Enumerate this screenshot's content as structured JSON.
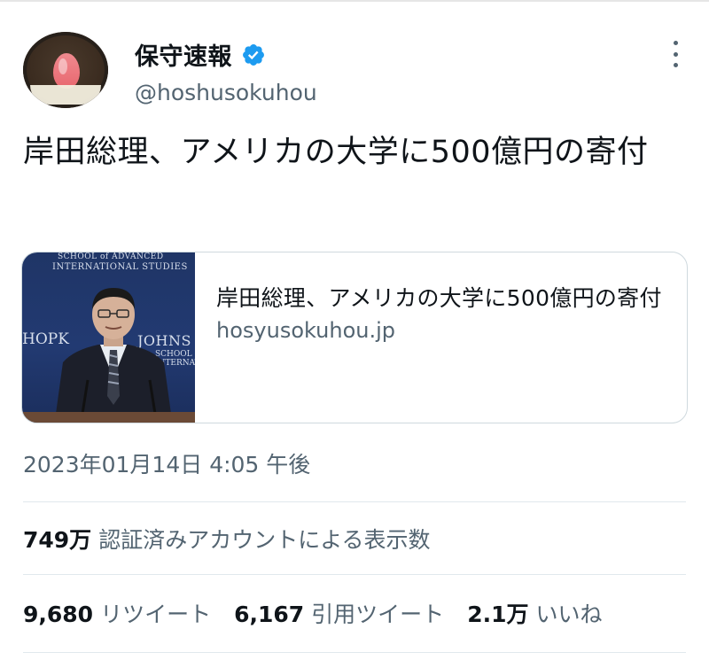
{
  "tweet": {
    "author": {
      "display_name": "保守速報",
      "handle": "@hoshusokuhou",
      "verified": true,
      "avatar_icon": "strawberry-mochi-avatar"
    },
    "text": "岸田総理、アメリカの大学に500億円の寄付",
    "link_card": {
      "title": "岸田総理、アメリカの大学に500億円の寄付",
      "domain": "hosyusokuhou.jp",
      "image_text": {
        "line1": "SCHOOL of ADVANCED",
        "line2": "INTERNATIONAL STUDIES",
        "line3": "JOHNS",
        "line4": "HOPK",
        "line5": "SCHOOL of",
        "line6": "INTERNATI"
      }
    },
    "timestamp": "2023年01月14日 4:05 午後",
    "views": {
      "count": "749万",
      "label": "認証済みアカウントによる表示数"
    },
    "stats": {
      "retweets": {
        "count": "9,680",
        "label": "リツイート"
      },
      "quotes": {
        "count": "6,167",
        "label": "引用ツイート"
      },
      "likes": {
        "count": "2.1万",
        "label": "いいね"
      }
    }
  },
  "colors": {
    "text_primary": "#0f1419",
    "text_secondary": "#536471",
    "verified_blue": "#1d9bf0",
    "border": "#cfd9de"
  },
  "icons": {
    "verified": "verified-badge-icon",
    "more": "more-options-icon"
  }
}
